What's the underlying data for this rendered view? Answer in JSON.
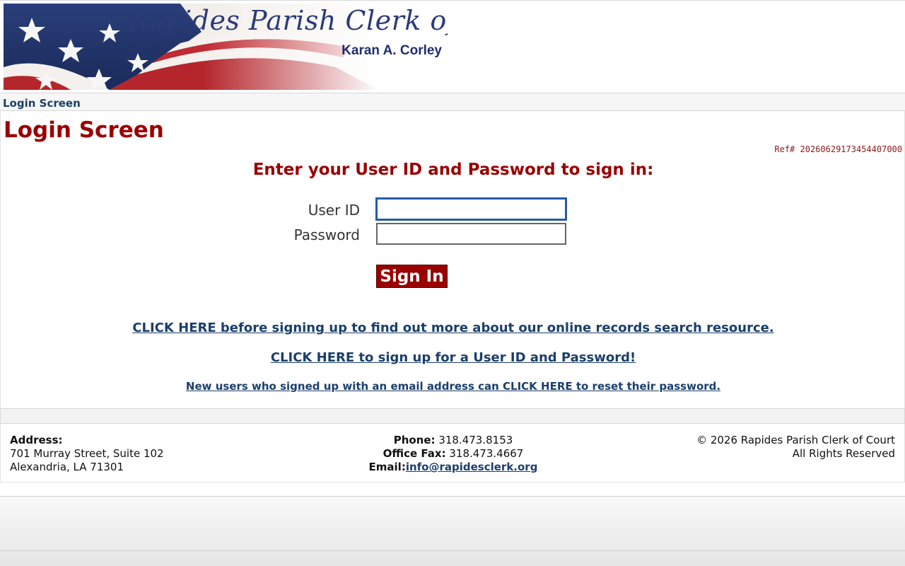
{
  "banner": {
    "title": "Rapides Parish Clerk of Court",
    "subtitle": "Karan A. Corley"
  },
  "breadcrumb": "Login Screen",
  "main": {
    "title": "Login Screen",
    "ref": "Ref# 20260629173454407000",
    "prompt": "Enter your User ID and Password to sign in:",
    "userid_label": "User ID",
    "password_label": "Password",
    "userid_value": "",
    "password_value": "",
    "signin_label": "Sign In",
    "link_info": "CLICK HERE before signing up to find out more about our online records search resource.",
    "link_signup": "CLICK HERE to sign up for a User ID and Password!",
    "link_reset": "New users who signed up with an email address can CLICK HERE to reset their password."
  },
  "footer": {
    "address_label": "Address:",
    "address_line1": "701 Murray Street, Suite 102",
    "address_line2": "Alexandria, LA 71301",
    "phone_label": "Phone:",
    "phone": "318.473.8153",
    "fax_label": "Office Fax:",
    "fax": "318.473.4667",
    "email_label": "Email:",
    "email": "info@rapidesclerk.org",
    "copyright": "© 2026 Rapides Parish Clerk of Court",
    "rights": "All Rights Reserved"
  },
  "colors": {
    "accent": "#990000",
    "link": "#1b3f6b",
    "banner_text": "#2b3a78"
  }
}
